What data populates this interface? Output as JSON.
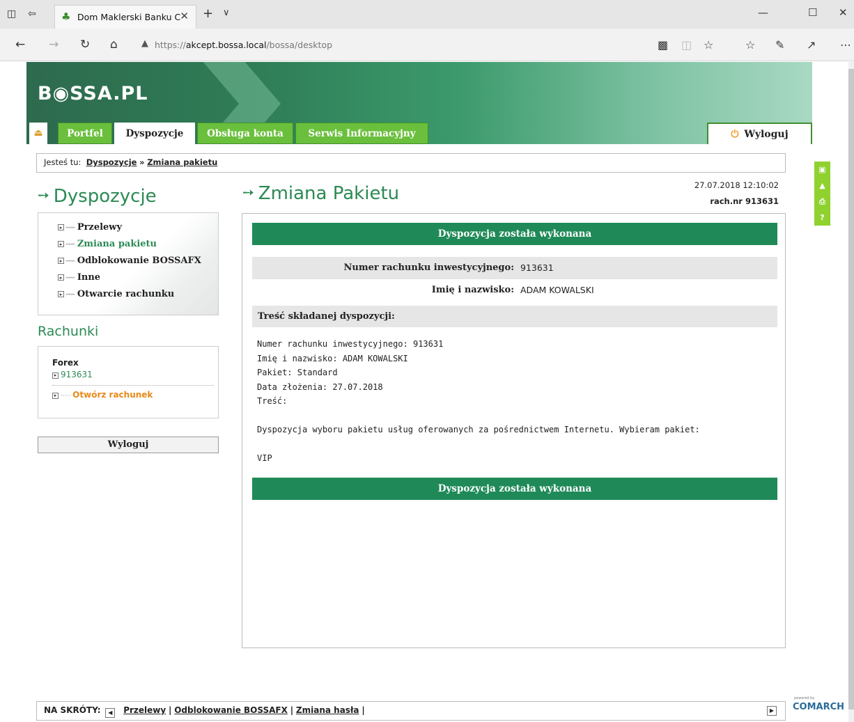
{
  "browser": {
    "tab_title": "Dom Maklerski Banku C",
    "url_prefix": "https://",
    "url_host": "akcept.bossa.local",
    "url_path": "/bossa/desktop"
  },
  "header": {
    "logo": "B◉SSA.PL",
    "tabs": [
      "Portfel",
      "Dyspozycje",
      "Obsługa konta",
      "Serwis Informacyjny"
    ],
    "logout": "Wyloguj"
  },
  "breadcrumb": {
    "prefix": "Jesteś tu:",
    "crumb1": "Dyspozycje",
    "sep": "»",
    "crumb2": "Zmiana pakietu"
  },
  "sidebar": {
    "title": "Dyspozycje",
    "items": [
      "Przelewy",
      "Zmiana pakietu",
      "Odblokowanie BOSSAFX",
      "Inne",
      "Otwarcie rachunku"
    ],
    "accounts_title": "Rachunki",
    "account_group": "Forex",
    "account_number": "913631",
    "open_account": "Otwórz rachunek",
    "logout": "Wyloguj"
  },
  "main": {
    "title": "Zmiana Pakietu",
    "datetime": "27.07.2018 12:10:02",
    "account_ref": "rach.nr 913631",
    "status": "Dyspozycja została wykonana",
    "fields": [
      {
        "label": "Numer rachunku inwestycyjnego:",
        "value": "913631"
      },
      {
        "label": "Imię i nazwisko:",
        "value": "ADAM KOWALSKI"
      }
    ],
    "section_title": "Treść składanej dyspozycji:",
    "body_lines": [
      "Numer rachunku inwestycyjnego: 913631",
      "Imię i nazwisko: ADAM KOWALSKI",
      "Pakiet: Standard",
      "Data złożenia: 27.07.2018",
      "Treść:",
      "",
      "Dyspozycja wyboru pakietu usług oferowanych za pośrednictwem Internetu. Wybieram pakiet:",
      "",
      "VIP"
    ]
  },
  "footer": {
    "label": "NA SKRÓTY:",
    "links": [
      "Przelewy",
      "Odblokowanie BOSSAFX",
      "Zmiana hasła"
    ],
    "sep": "|",
    "brand_small": "powered by",
    "brand": "COMARCH"
  }
}
